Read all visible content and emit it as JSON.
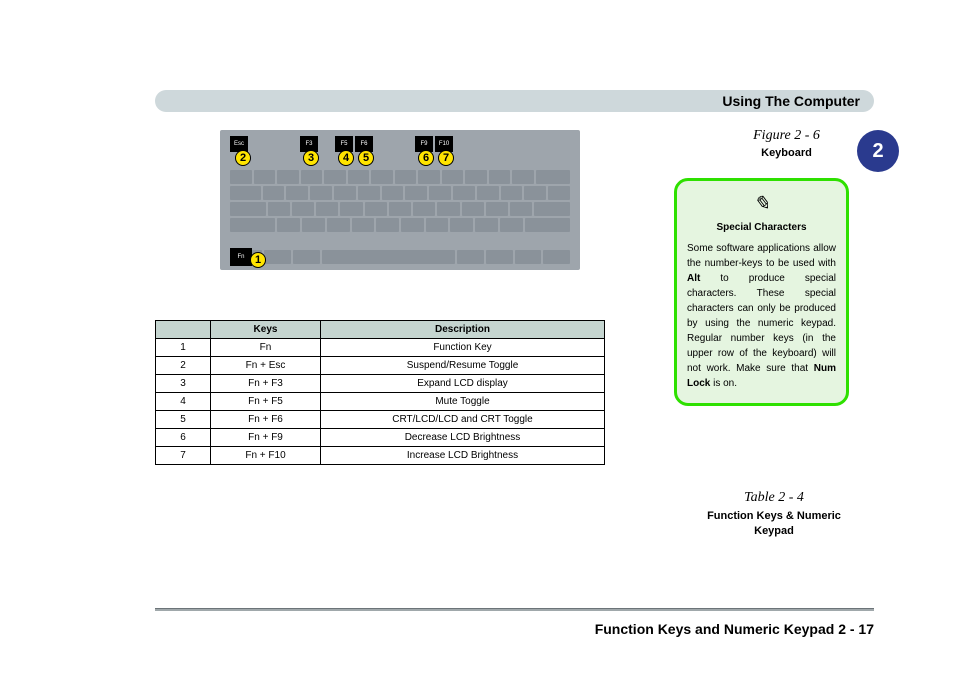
{
  "header": {
    "title": "Using The Computer"
  },
  "chapter": "2",
  "figure": {
    "label": "Figure 2 - 6",
    "name": "Keyboard"
  },
  "keyboard": {
    "hl_keys": {
      "esc": "Esc",
      "f3": "F3",
      "f5": "F5",
      "f6": "F6",
      "f9": "F9",
      "f10": "F10",
      "fn": "Fn"
    },
    "markers": [
      "1",
      "2",
      "3",
      "4",
      "5",
      "6",
      "7"
    ]
  },
  "table": {
    "headers": [
      "",
      "Keys",
      "Description"
    ],
    "rows": [
      [
        "1",
        "Fn",
        "Function Key"
      ],
      [
        "2",
        "Fn + Esc",
        "Suspend/Resume Toggle"
      ],
      [
        "3",
        "Fn + F3",
        "Expand LCD display"
      ],
      [
        "4",
        "Fn + F5",
        "Mute Toggle"
      ],
      [
        "5",
        "Fn + F6",
        "CRT/LCD/LCD and CRT Toggle"
      ],
      [
        "6",
        "Fn + F9",
        "Decrease LCD Brightness"
      ],
      [
        "7",
        "Fn + F10",
        "Increase LCD Brightness"
      ]
    ]
  },
  "callout": {
    "icon": "✎",
    "title": "Special Characters",
    "body_pre": "Some software applications allow the number-keys to be used with ",
    "alt": "Alt",
    "body_mid": " to produce special characters. These special characters can only be produced by using the numeric keypad. Regular number keys (in the upper row of the keyboard) will not work. Make sure that ",
    "numlock": "Num Lock",
    "body_post": " is on."
  },
  "table_caption": {
    "label": "Table 2 - 4",
    "name": "Function Keys & Numeric Keypad"
  },
  "footer": "Function Keys and Numeric Keypad  2  -  17"
}
